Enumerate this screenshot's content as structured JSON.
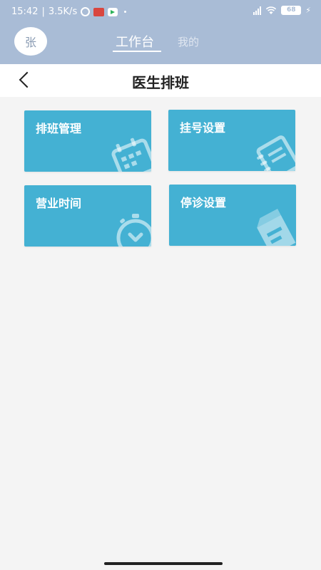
{
  "status_bar": {
    "time": "15:42",
    "separator": "|",
    "network_speed": "3.5K/s",
    "battery_level": "68",
    "icons": [
      "alarm-icon",
      "news-app-icon",
      "video-app-icon",
      "signal-icon",
      "wifi-icon",
      "battery-icon",
      "charging-icon"
    ]
  },
  "header": {
    "avatar_text": "张",
    "tabs": [
      {
        "label": "工作台",
        "active": true
      },
      {
        "label": "我的",
        "active": false
      }
    ],
    "background_color": "#a9bcd6"
  },
  "navbar": {
    "title": "医生排班",
    "back_icon": "chevron-left-icon"
  },
  "tiles": [
    {
      "label": "排班管理",
      "icon": "calendar-icon"
    },
    {
      "label": "挂号设置",
      "icon": "notebook-icon"
    },
    {
      "label": "营业时间",
      "icon": "stopwatch-icon"
    },
    {
      "label": "停诊设置",
      "icon": "document-icon"
    }
  ],
  "colors": {
    "tile": "#44b1d3",
    "page_background": "#f4f4f4"
  }
}
